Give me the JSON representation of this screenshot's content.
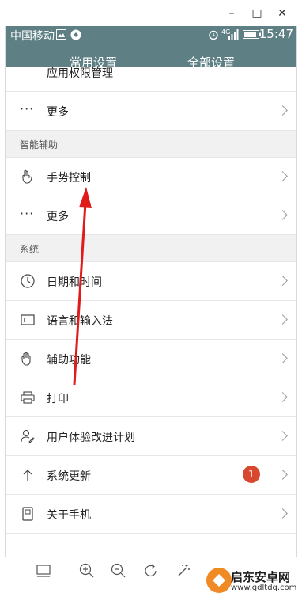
{
  "window": {
    "minimize_label": "–",
    "maximize_label": "□",
    "close_label": "✕"
  },
  "statusbar": {
    "carrier": "中国移动",
    "network": "4G",
    "time": "15:47",
    "icons": [
      "image-icon",
      "shield-app-icon",
      "alarm-icon",
      "signal-icon",
      "battery-icon"
    ]
  },
  "tabs": [
    {
      "label": "常用设置",
      "active": false
    },
    {
      "label": "全部设置",
      "active": true
    }
  ],
  "list": {
    "partial_item": "应用权限管理",
    "more_1": "更多",
    "section_assist": "智能辅助",
    "gesture": "手势控制",
    "more_2": "更多",
    "section_system": "系统",
    "datetime": "日期和时间",
    "language": "语言和输入法",
    "accessibility": "辅助功能",
    "print": "打印",
    "ux_plan": "用户体验改进计划",
    "update": "系统更新",
    "update_badge": "1",
    "about": "关于手机"
  },
  "watermark": {
    "name": "启东安卓网",
    "url": "www.qdltdq.com"
  },
  "colors": {
    "header": "#5e7f84",
    "badge": "#d8482f",
    "arrow": "#e01b1b"
  }
}
